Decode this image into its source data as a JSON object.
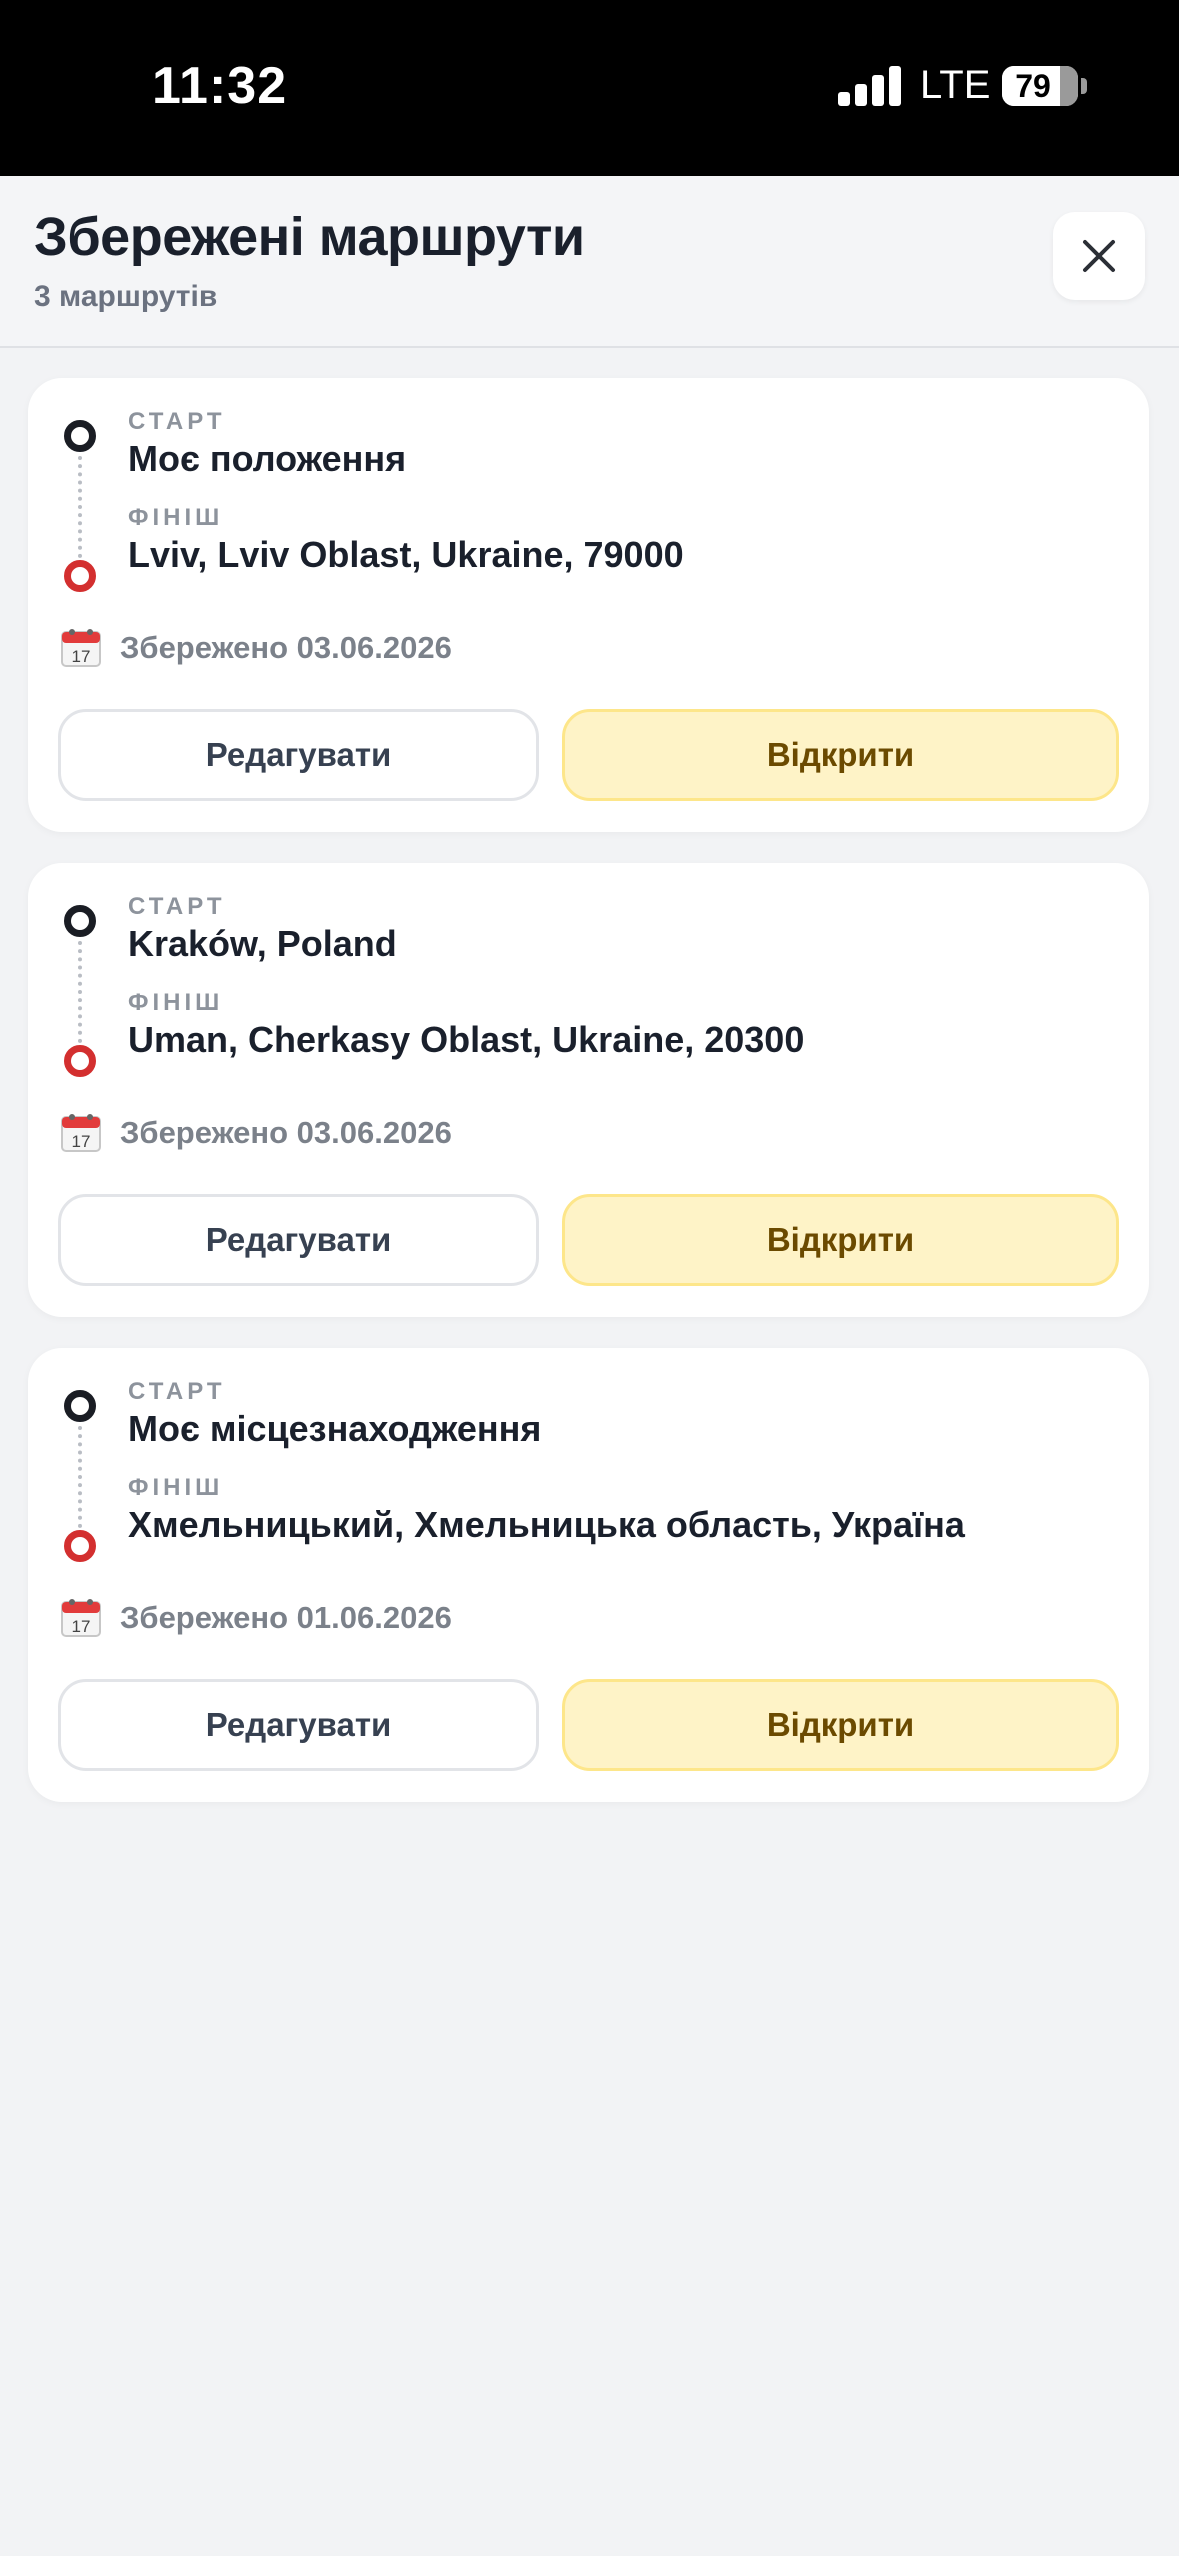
{
  "status_bar": {
    "time": "11:32",
    "network": "LTE",
    "battery": "79"
  },
  "header": {
    "title": "Збережені маршрути",
    "subtitle": "3 маршрутів",
    "close_icon": "close-icon"
  },
  "labels": {
    "start": "СТАРТ",
    "finish": "ФІНІШ"
  },
  "routes": [
    {
      "start": "Моє положення",
      "finish": "Lviv, Lviv Oblast, Ukraine, 79000",
      "saved": "Збережено 03.06.2026",
      "edit_label": "Редагувати",
      "open_label": "Відкрити"
    },
    {
      "start": "Kraków, Poland",
      "finish": "Uman, Cherkasy Oblast, Ukraine, 20300",
      "saved": "Збережено 03.06.2026",
      "edit_label": "Редагувати",
      "open_label": "Відкрити"
    },
    {
      "start": "Моє місцезнаходження",
      "finish": "Хмельницький, Хмельницька область, Україна",
      "saved": "Збережено 01.06.2026",
      "edit_label": "Редагувати",
      "open_label": "Відкрити"
    }
  ],
  "colors": {
    "accent_bg": "#fef3c7",
    "accent_text": "#6b4a00",
    "finish_dot": "#d32f2f",
    "start_dot": "#1a1d24"
  }
}
